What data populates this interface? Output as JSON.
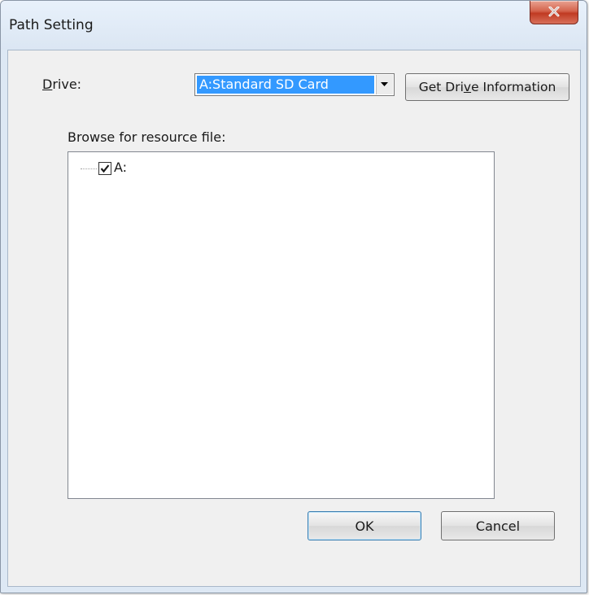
{
  "window": {
    "title": "Path Setting",
    "close_icon": "close-x"
  },
  "drive": {
    "label_prefix": "",
    "label_mnemonic": "D",
    "label_rest": "rive:",
    "selected_value": "A:Standard SD Card",
    "dropdown_icon": "dropdown-arrow"
  },
  "get_drive_button": {
    "label_before": "Get Dri",
    "label_mnemonic": "v",
    "label_after": "e Information"
  },
  "browse": {
    "label": "Browse for resource file:",
    "tree_items": [
      {
        "label": "A:",
        "checked": true
      }
    ]
  },
  "buttons": {
    "ok": "OK",
    "cancel": "Cancel"
  },
  "colors": {
    "selection": "#3399ff",
    "close_button": "#c03a22",
    "dialog_background": "#f0f0f0"
  }
}
